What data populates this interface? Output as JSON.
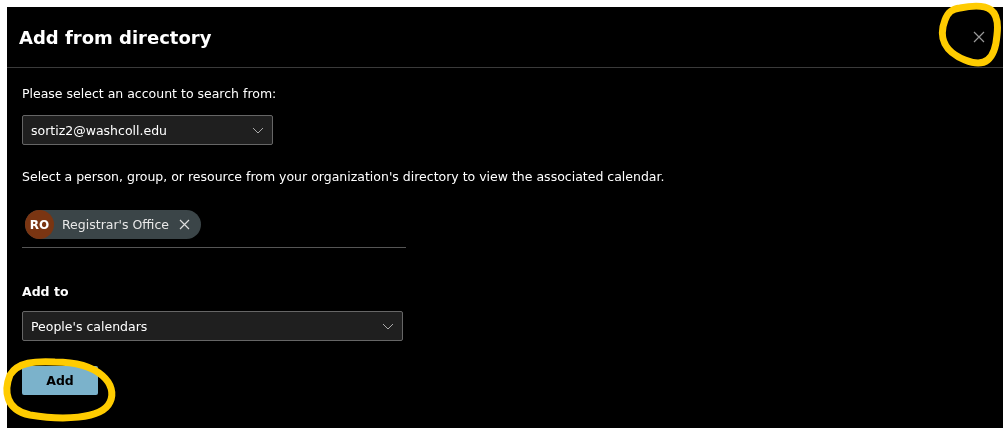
{
  "dialog": {
    "title": "Add from directory"
  },
  "account": {
    "label": "Please select an account to search from:",
    "value": "sortiz2@washcoll.edu"
  },
  "instructions": "Select a person, group, or resource from your organization's directory to view the associated calendar.",
  "selected_people": [
    {
      "initials": "RO",
      "name": "Registrar's Office",
      "color": "#7a3512"
    }
  ],
  "add_to": {
    "label": "Add to",
    "value": "People's calendars"
  },
  "buttons": [
    {
      "label": "Add",
      "kind": "primary"
    }
  ]
}
